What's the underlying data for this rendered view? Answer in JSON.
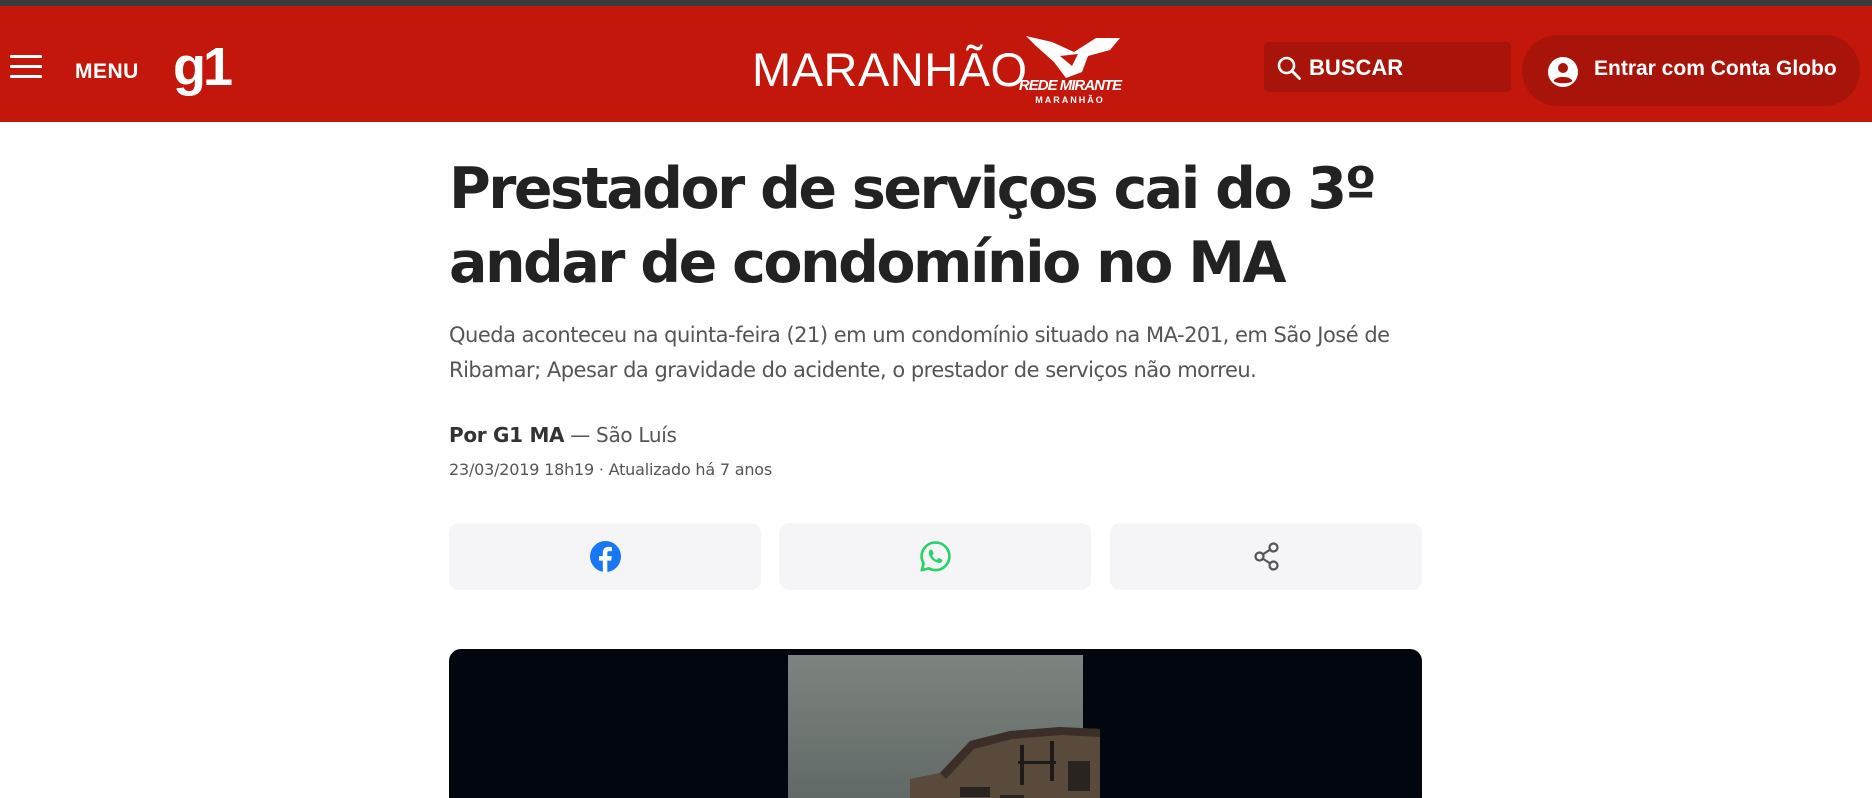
{
  "header": {
    "menu_label": "MENU",
    "site_logo": "g1",
    "region": "MARANHÃO",
    "affiliate_logo": {
      "line1": "REDE MIRANTE",
      "line2": "MARANHÃO"
    },
    "search_label": "BUSCAR",
    "login_label": "Entrar com Conta Globo",
    "brand_color": "#c4170c",
    "icons": {
      "menu": "hamburger-icon",
      "search": "search-icon",
      "user": "user-icon"
    }
  },
  "article": {
    "title": "Prestador de serviços cai do 3º andar de condomínio no MA",
    "subtitle": "Queda aconteceu na quinta-feira (21) em um condomínio situado na MA-201, em São José de Ribamar; Apesar da gravidade do acidente, o prestador de serviços não morreu.",
    "byline_prefix": "Por",
    "author": "G1 MA",
    "location": "— São Luís",
    "dateline": "23/03/2019 18h19 · Atualizado há 7 anos"
  },
  "share": {
    "buttons": [
      {
        "icon": "facebook-icon",
        "color": "#1877f2"
      },
      {
        "icon": "whatsapp-icon",
        "color": "#25d366"
      },
      {
        "icon": "share-icon",
        "color": "#555555"
      }
    ]
  }
}
